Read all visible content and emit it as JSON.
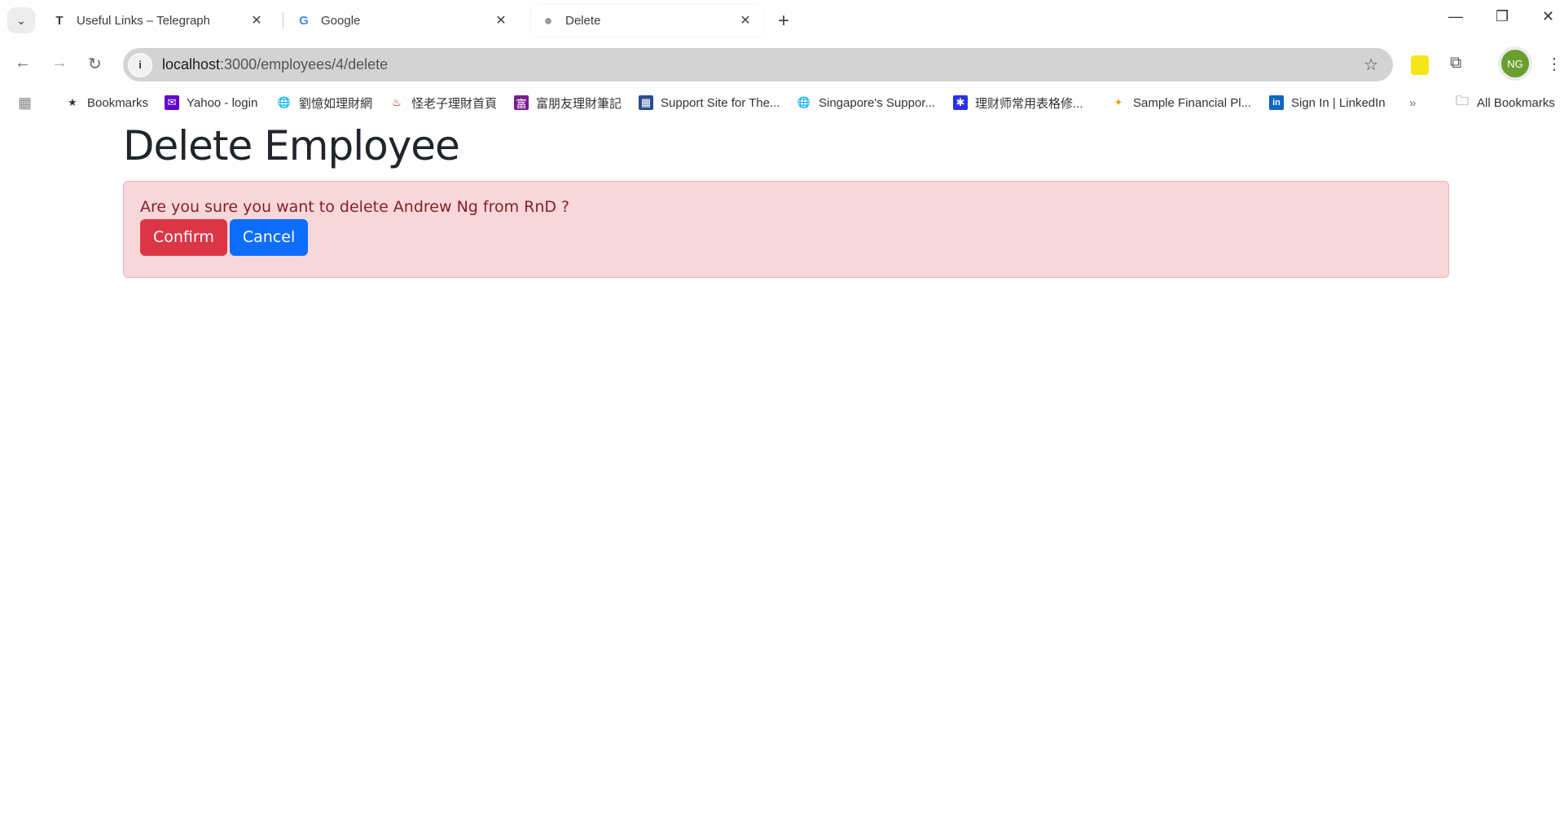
{
  "browser": {
    "tabs": [
      {
        "label": "Useful Links – Telegraph",
        "icon": "T"
      },
      {
        "label": "Google",
        "icon": "G"
      },
      {
        "label": "Delete",
        "icon": "globe"
      }
    ],
    "url_host": "localhost",
    "url_path": ":3000/employees/4/delete",
    "profile_initials": "NG",
    "bookmarks": [
      "Bookmarks",
      "Yahoo - login",
      "劉憶如理財網",
      "怪老子理財首頁",
      "富朋友理財筆記",
      "Support Site for The...",
      "Singapore's Suppor...",
      "理财师常用表格修...",
      "Sample Financial Pl...",
      "Sign In | LinkedIn"
    ],
    "all_bookmarks": "All Bookmarks"
  },
  "page": {
    "title": "Delete Employee",
    "message": "Are you sure you want to delete Andrew Ng from RnD ?",
    "confirm_label": "Confirm",
    "cancel_label": "Cancel"
  },
  "colors": {
    "danger": "#dc3545",
    "primary": "#0d6efd",
    "alert_bg": "#f8d7da",
    "alert_text": "#842029"
  }
}
